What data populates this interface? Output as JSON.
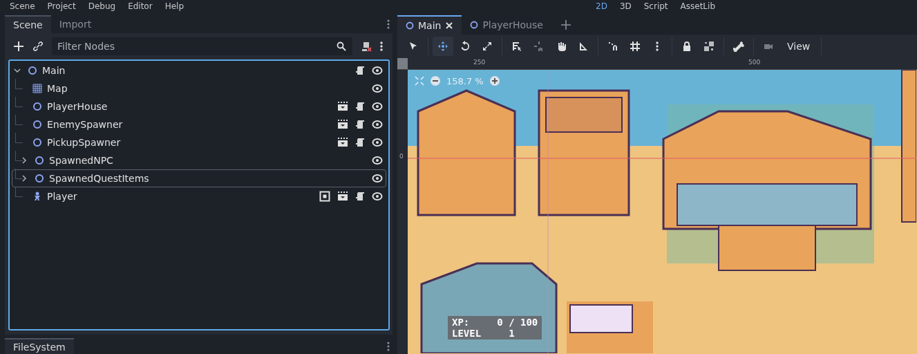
{
  "menu": [
    "Scene",
    "Project",
    "Debug",
    "Editor",
    "Help"
  ],
  "workspaces": [
    {
      "label": "2D",
      "selected": true
    },
    {
      "label": "3D",
      "selected": false
    },
    {
      "label": "Script",
      "selected": false
    },
    {
      "label": "AssetLib",
      "selected": false
    }
  ],
  "dock_tabs": [
    {
      "label": "Scene",
      "selected": true
    },
    {
      "label": "Import",
      "selected": false
    }
  ],
  "filter": {
    "placeholder": "Filter Nodes"
  },
  "tree": [
    {
      "name": "Main",
      "kind": "node",
      "expanded": true,
      "script": true,
      "children": [
        {
          "name": "Map",
          "kind": "tilemap",
          "selected": false
        },
        {
          "name": "PlayerHouse",
          "kind": "node",
          "selected": false,
          "script": true,
          "instance": true
        },
        {
          "name": "EnemySpawner",
          "kind": "node",
          "selected": false,
          "script": true,
          "instance": true
        },
        {
          "name": "PickupSpawner",
          "kind": "node",
          "selected": false,
          "script": true,
          "instance": true
        },
        {
          "name": "SpawnedNPC",
          "kind": "node",
          "expanded": false,
          "selected": false
        },
        {
          "name": "SpawnedQuestItems",
          "kind": "node",
          "expanded": false,
          "selected": true
        },
        {
          "name": "Player",
          "kind": "character",
          "selected": false,
          "script": true,
          "instance": true,
          "unique": true
        }
      ]
    }
  ],
  "bottom_dock": {
    "label": "FileSystem"
  },
  "scene_tabs": [
    {
      "label": "Main",
      "selected": true
    },
    {
      "label": "PlayerHouse",
      "selected": false
    }
  ],
  "tools": [
    {
      "kind": "select",
      "selected": false,
      "disabled": false
    },
    {
      "kind": "move",
      "selected": true,
      "disabled": false
    },
    {
      "kind": "rotate",
      "selected": false,
      "disabled": false
    },
    {
      "kind": "scale",
      "selected": false,
      "disabled": false
    },
    {
      "kind": "list",
      "selected": false,
      "disabled": false
    },
    {
      "kind": "pivot",
      "selected": false,
      "disabled": true
    },
    {
      "kind": "pan",
      "selected": false,
      "disabled": false
    },
    {
      "kind": "ruler",
      "selected": false,
      "disabled": false
    },
    {
      "kind": "snap",
      "selected": false,
      "disabled": false
    },
    {
      "kind": "grid",
      "selected": false,
      "disabled": false
    },
    {
      "kind": "more",
      "selected": false,
      "disabled": false
    },
    {
      "kind": "lock",
      "selected": false,
      "disabled": false
    },
    {
      "kind": "group",
      "selected": false,
      "disabled": false
    },
    {
      "kind": "bone",
      "selected": false,
      "disabled": false
    },
    {
      "kind": "camera",
      "selected": false,
      "disabled": true
    }
  ],
  "view_menu": "View",
  "ruler": {
    "x_labels": [
      "250",
      "500"
    ],
    "y_label": "0"
  },
  "zoom": "158.7 %",
  "hud": {
    "xp_label": "XP:",
    "xp_value": "0 / 100",
    "level_label": "LEVEL",
    "level_value": "1"
  }
}
